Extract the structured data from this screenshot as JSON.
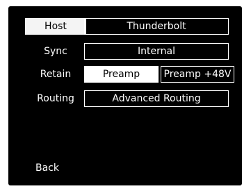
{
  "menu": {
    "host": {
      "label": "Host",
      "value": "Thunderbolt"
    },
    "sync": {
      "label": "Sync",
      "value": "Internal"
    },
    "retain": {
      "label": "Retain",
      "options": [
        "Preamp",
        "Preamp +48V"
      ],
      "selected": "Preamp"
    },
    "routing": {
      "label": "Routing",
      "value": "Advanced Routing"
    },
    "back": "Back"
  },
  "colors": {
    "background": "#000000",
    "foreground": "#ffffff",
    "selected_label_bg": "#f4f4f4"
  }
}
